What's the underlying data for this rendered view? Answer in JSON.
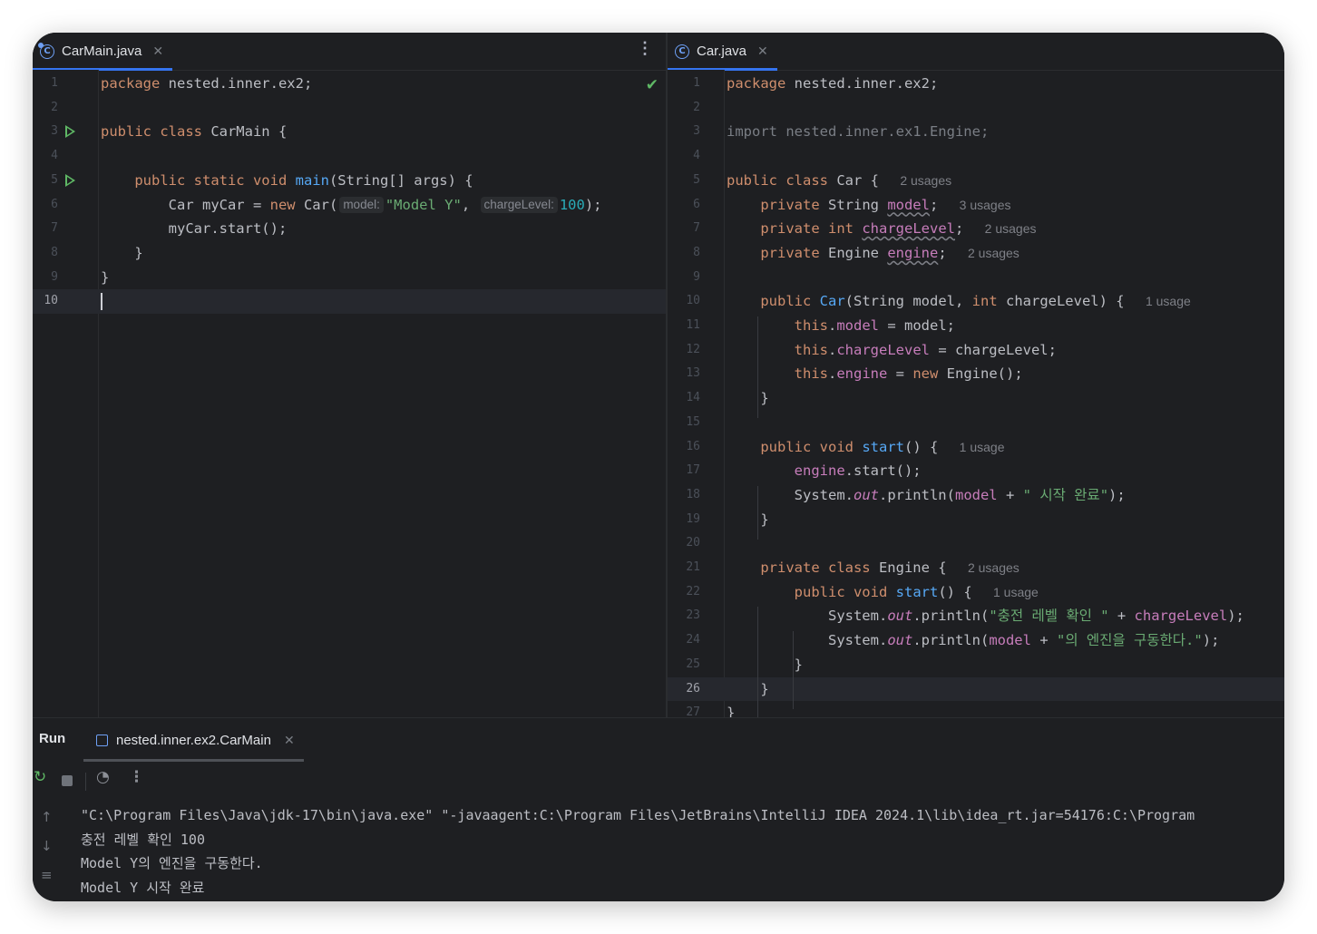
{
  "left_editor": {
    "tab": {
      "label": "CarMain.java",
      "icon": "java-class-icon"
    },
    "current_line": "10",
    "lines": [
      {
        "n": "1",
        "segs": [
          {
            "t": "package",
            "c": "kw"
          },
          {
            "t": " nested.inner.ex2;",
            "c": ""
          }
        ]
      },
      {
        "n": "2",
        "segs": []
      },
      {
        "n": "3",
        "run": true,
        "segs": [
          {
            "t": "public class",
            "c": "kw"
          },
          {
            "t": " CarMain {",
            "c": ""
          }
        ]
      },
      {
        "n": "4",
        "segs": []
      },
      {
        "n": "5",
        "run": true,
        "segs": [
          {
            "t": "    public static void ",
            "c": "kw"
          },
          {
            "t": "main",
            "c": "fn"
          },
          {
            "t": "(String[] args) {",
            "c": ""
          }
        ]
      },
      {
        "n": "6",
        "segs": [
          {
            "t": "        Car myCar = ",
            "c": ""
          },
          {
            "t": "new",
            "c": "kw"
          },
          {
            "t": " Car(",
            "c": ""
          },
          {
            "t": "model:",
            "c": "hint"
          },
          {
            "t": "\"Model Y\"",
            "c": "str"
          },
          {
            "t": ", ",
            "c": ""
          },
          {
            "t": "chargeLevel:",
            "c": "hint"
          },
          {
            "t": "100",
            "c": "num"
          },
          {
            "t": ");",
            "c": ""
          }
        ]
      },
      {
        "n": "7",
        "segs": [
          {
            "t": "        myCar.start();",
            "c": ""
          }
        ]
      },
      {
        "n": "8",
        "segs": [
          {
            "t": "    }",
            "c": ""
          }
        ]
      },
      {
        "n": "9",
        "segs": [
          {
            "t": "}",
            "c": ""
          }
        ]
      },
      {
        "n": "10",
        "caret": true,
        "segs": []
      }
    ]
  },
  "right_editor": {
    "tab": {
      "label": "Car.java",
      "icon": "java-class-icon"
    },
    "current_line": "26",
    "lines": [
      {
        "n": "1",
        "segs": [
          {
            "t": "package",
            "c": "kw"
          },
          {
            "t": " nested.inner.ex2;",
            "c": ""
          }
        ]
      },
      {
        "n": "2",
        "segs": []
      },
      {
        "n": "3",
        "segs": [
          {
            "t": "import nested.inner.ex1.Engine;",
            "c": "dim"
          }
        ]
      },
      {
        "n": "4",
        "segs": []
      },
      {
        "n": "5",
        "segs": [
          {
            "t": "public class",
            "c": "kw"
          },
          {
            "t": " Car { ",
            "c": ""
          },
          {
            "t": "2 usages",
            "c": "usage"
          }
        ]
      },
      {
        "n": "6",
        "segs": [
          {
            "t": "    private",
            "c": "kw"
          },
          {
            "t": " String ",
            "c": ""
          },
          {
            "t": "model",
            "c": "fld ul"
          },
          {
            "t": "; ",
            "c": ""
          },
          {
            "t": "3 usages",
            "c": "usage"
          }
        ]
      },
      {
        "n": "7",
        "segs": [
          {
            "t": "    private int",
            "c": "kw"
          },
          {
            "t": " ",
            "c": ""
          },
          {
            "t": "chargeLevel",
            "c": "fld ul"
          },
          {
            "t": "; ",
            "c": ""
          },
          {
            "t": "2 usages",
            "c": "usage"
          }
        ]
      },
      {
        "n": "8",
        "segs": [
          {
            "t": "    private",
            "c": "kw"
          },
          {
            "t": " Engine ",
            "c": ""
          },
          {
            "t": "engine",
            "c": "fld ul"
          },
          {
            "t": "; ",
            "c": ""
          },
          {
            "t": "2 usages",
            "c": "usage"
          }
        ]
      },
      {
        "n": "9",
        "segs": []
      },
      {
        "n": "10",
        "segs": [
          {
            "t": "    public",
            "c": "kw"
          },
          {
            "t": " ",
            "c": ""
          },
          {
            "t": "Car",
            "c": "fn"
          },
          {
            "t": "(String model, ",
            "c": ""
          },
          {
            "t": "int",
            "c": "kw"
          },
          {
            "t": " chargeLevel) { ",
            "c": ""
          },
          {
            "t": "1 usage",
            "c": "usage"
          }
        ]
      },
      {
        "n": "11",
        "segs": [
          {
            "t": "        this",
            "c": "kw"
          },
          {
            "t": ".",
            "c": ""
          },
          {
            "t": "model",
            "c": "fld"
          },
          {
            "t": " = model;",
            "c": ""
          }
        ]
      },
      {
        "n": "12",
        "segs": [
          {
            "t": "        this",
            "c": "kw"
          },
          {
            "t": ".",
            "c": ""
          },
          {
            "t": "chargeLevel",
            "c": "fld"
          },
          {
            "t": " = chargeLevel;",
            "c": ""
          }
        ]
      },
      {
        "n": "13",
        "segs": [
          {
            "t": "        this",
            "c": "kw"
          },
          {
            "t": ".",
            "c": ""
          },
          {
            "t": "engine",
            "c": "fld"
          },
          {
            "t": " = ",
            "c": ""
          },
          {
            "t": "new",
            "c": "kw"
          },
          {
            "t": " Engine();",
            "c": ""
          }
        ]
      },
      {
        "n": "14",
        "segs": [
          {
            "t": "    }",
            "c": ""
          }
        ]
      },
      {
        "n": "15",
        "segs": []
      },
      {
        "n": "16",
        "segs": [
          {
            "t": "    public void",
            "c": "kw"
          },
          {
            "t": " ",
            "c": ""
          },
          {
            "t": "start",
            "c": "fn"
          },
          {
            "t": "() { ",
            "c": ""
          },
          {
            "t": "1 usage",
            "c": "usage"
          }
        ]
      },
      {
        "n": "17",
        "segs": [
          {
            "t": "        ",
            "c": ""
          },
          {
            "t": "engine",
            "c": "fld"
          },
          {
            "t": ".start();",
            "c": ""
          }
        ]
      },
      {
        "n": "18",
        "segs": [
          {
            "t": "        System.",
            "c": ""
          },
          {
            "t": "out",
            "c": "it"
          },
          {
            "t": ".println(",
            "c": ""
          },
          {
            "t": "model",
            "c": "fld"
          },
          {
            "t": " + ",
            "c": ""
          },
          {
            "t": "\" 시작 완료\"",
            "c": "str"
          },
          {
            "t": ");",
            "c": ""
          }
        ]
      },
      {
        "n": "19",
        "segs": [
          {
            "t": "    }",
            "c": ""
          }
        ]
      },
      {
        "n": "20",
        "segs": []
      },
      {
        "n": "21",
        "segs": [
          {
            "t": "    private class",
            "c": "kw"
          },
          {
            "t": " Engine { ",
            "c": ""
          },
          {
            "t": "2 usages",
            "c": "usage"
          }
        ]
      },
      {
        "n": "22",
        "segs": [
          {
            "t": "        public void",
            "c": "kw"
          },
          {
            "t": " ",
            "c": ""
          },
          {
            "t": "start",
            "c": "fn"
          },
          {
            "t": "() { ",
            "c": ""
          },
          {
            "t": "1 usage",
            "c": "usage"
          }
        ]
      },
      {
        "n": "23",
        "segs": [
          {
            "t": "            System.",
            "c": ""
          },
          {
            "t": "out",
            "c": "it"
          },
          {
            "t": ".println(",
            "c": ""
          },
          {
            "t": "\"충전 레벨 확인 \"",
            "c": "str"
          },
          {
            "t": " + ",
            "c": ""
          },
          {
            "t": "chargeLevel",
            "c": "fld"
          },
          {
            "t": ");",
            "c": ""
          }
        ]
      },
      {
        "n": "24",
        "segs": [
          {
            "t": "            System.",
            "c": ""
          },
          {
            "t": "out",
            "c": "it"
          },
          {
            "t": ".println(",
            "c": ""
          },
          {
            "t": "model",
            "c": "fld"
          },
          {
            "t": " + ",
            "c": ""
          },
          {
            "t": "\"의 엔진을 구동한다.\"",
            "c": "str"
          },
          {
            "t": ");",
            "c": ""
          }
        ]
      },
      {
        "n": "25",
        "segs": [
          {
            "t": "        }",
            "c": ""
          }
        ]
      },
      {
        "n": "26",
        "segs": [
          {
            "t": "    }",
            "c": ""
          }
        ]
      },
      {
        "n": "27",
        "segs": [
          {
            "t": "}",
            "c": ""
          }
        ]
      }
    ]
  },
  "run_panel": {
    "title": "Run",
    "tab_label": "nested.inner.ex2.CarMain",
    "output": [
      "\"C:\\Program Files\\Java\\jdk-17\\bin\\java.exe\" \"-javaagent:C:\\Program Files\\JetBrains\\IntelliJ IDEA 2024.1\\lib\\idea_rt.jar=54176:C:\\Program",
      "충전 레벨 확인 100",
      "Model Y의 엔진을 구동한다.",
      "Model Y 시작 완료"
    ]
  },
  "colors": {
    "background": "#1e1f22",
    "keyword": "#cf8e6d",
    "function": "#56a8f5",
    "field": "#c77dbb",
    "string": "#6aab73",
    "number": "#2aacb8",
    "accent": "#3574f0",
    "run_icon": "#5fb865"
  }
}
